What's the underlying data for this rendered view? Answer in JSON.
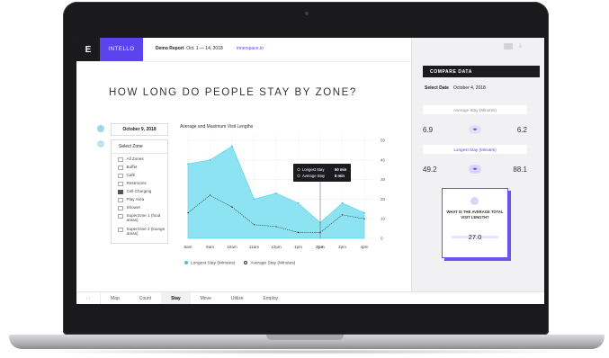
{
  "topbar": {
    "logo": "E",
    "brand": "INTELLO",
    "report_label": "Demo Report",
    "report_dates": "Oct. 1 — 14, 2018",
    "domain": "innerspace.io"
  },
  "page_title": "HOW LONG DO PEOPLE STAY BY ZONE?",
  "filters": {
    "date": "October 9, 2018",
    "zone_header": "Select Zone",
    "zones": [
      {
        "label": "All Zones",
        "checked": false
      },
      {
        "label": "Buffet",
        "checked": false
      },
      {
        "label": "Café",
        "checked": false
      },
      {
        "label": "Restrooms",
        "checked": false
      },
      {
        "label": "Cell Charging",
        "checked": true
      },
      {
        "label": "Play Area",
        "checked": false
      },
      {
        "label": "Shower",
        "checked": false
      },
      {
        "label": "Superzone 1 (food areas)",
        "checked": false
      },
      {
        "label": "Superzone 2 (lounge areas)",
        "checked": false
      }
    ]
  },
  "chart_data": {
    "type": "area",
    "title": "Average and Maximum Visit Lengths",
    "categories": [
      "8am",
      "9am",
      "10am",
      "11am",
      "12pm",
      "1pm",
      "2pm",
      "3pm",
      "4pm"
    ],
    "series": [
      {
        "name": "Longest Stay (Minutes)",
        "values": [
          38,
          40,
          47,
          20,
          23,
          18,
          8,
          18,
          13
        ]
      },
      {
        "name": "Average Stay (Minutes)",
        "values": [
          13,
          22,
          16,
          7,
          6,
          3,
          3,
          12,
          10
        ]
      }
    ],
    "yticks": [
      "50",
      "40",
      "30",
      "20",
      "10",
      "0"
    ],
    "ylim": [
      0,
      50
    ],
    "grid": true,
    "tooltip": {
      "category": "2pm",
      "rows": [
        {
          "label": "Longest Stay",
          "value": "50 min"
        },
        {
          "label": "Average Stay",
          "value": "8 min"
        }
      ]
    },
    "colors": {
      "longest": "#8ee3f2",
      "average": "#2a2a2a"
    }
  },
  "legend": {
    "longest": "Longest Stay (Minutes)",
    "average": "Average Stay (Minutes)"
  },
  "tabs": [
    "Map",
    "Count",
    "Stay",
    "Move",
    "Utilize",
    "Employ"
  ],
  "active_tab": "Stay",
  "compare": {
    "header": "COMPARE DATA",
    "select_date_label": "Select Date",
    "select_date_value": "October 4, 2018",
    "avg_label": "Average Stay (Minutes)",
    "avg_left": "6.9",
    "avg_right": "6.2",
    "long_label": "Longest Stay (Minutes)",
    "long_left": "49.2",
    "long_right": "88.1",
    "question": "WHAT IS THE AVERAGE TOTAL VISIT LENGTH?",
    "answer": "27.0"
  },
  "colors": {
    "accent": "#5b43ee",
    "area": "#8ee3f2",
    "dark": "#1b1b1f"
  }
}
